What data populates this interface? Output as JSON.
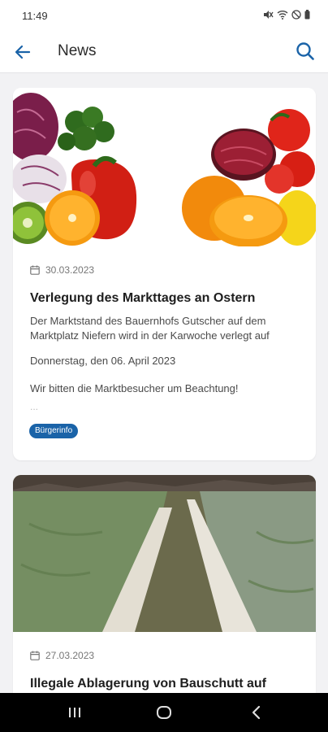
{
  "status_bar": {
    "time": "11:49",
    "icons": [
      "mute-icon",
      "wifi-icon",
      "dnd-icon",
      "battery-icon"
    ]
  },
  "app_bar": {
    "title": "News",
    "back_icon": "arrow-left-icon",
    "search_icon": "search-icon",
    "accent": "#1a63a8"
  },
  "news": [
    {
      "date": "30.03.2023",
      "title": "Verlegung des Markttages an Ostern",
      "body": [
        "Der Marktstand des Bauernhofs Gutscher auf dem Marktplatz Niefern wird in der Karwoche verlegt auf",
        "Donnerstag, den 06. April 2023",
        "Wir bitten die Marktbesucher um Beachtung!"
      ],
      "ellipsis": "...",
      "tag": "Bürgerinfo"
    },
    {
      "date": "27.03.2023",
      "title": "Illegale Ablagerung von Bauschutt auf"
    }
  ],
  "nav_bar": {
    "buttons": [
      "recents-icon",
      "home-icon",
      "back-icon"
    ]
  }
}
